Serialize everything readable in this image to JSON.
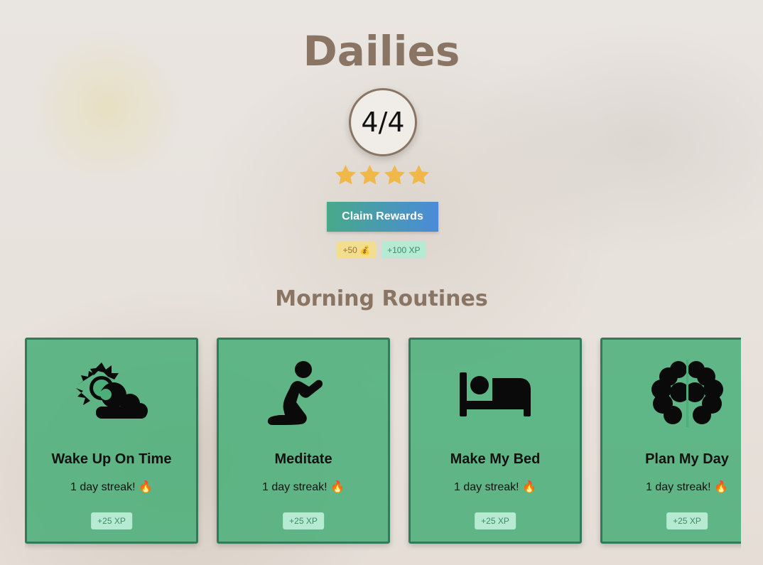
{
  "header": {
    "title": "Dailies",
    "progress": "4/4",
    "stars_filled": 4,
    "stars_total": 4
  },
  "rewards": {
    "claim_label": "Claim Rewards",
    "coins": "+50 💰",
    "xp": "+100 XP"
  },
  "section": {
    "title": "Morning Routines"
  },
  "routines": [
    {
      "name": "Wake Up On Time",
      "streak": "1 day streak! 🔥",
      "xp": "+25 XP",
      "icon": "sun-cloud-icon"
    },
    {
      "name": "Meditate",
      "streak": "1 day streak! 🔥",
      "xp": "+25 XP",
      "icon": "praying-person-icon"
    },
    {
      "name": "Make My Bed",
      "streak": "1 day streak! 🔥",
      "xp": "+25 XP",
      "icon": "bed-icon"
    },
    {
      "name": "Plan My Day",
      "streak": "1 day streak! 🔥",
      "xp": "+25 XP",
      "icon": "brain-icon"
    }
  ],
  "colors": {
    "title": "#8a7565",
    "card_bg": "#4caf7a",
    "card_border": "#327a58",
    "star": "#f0b84a",
    "button_start": "#47a98a",
    "button_end": "#4a8bd9"
  }
}
